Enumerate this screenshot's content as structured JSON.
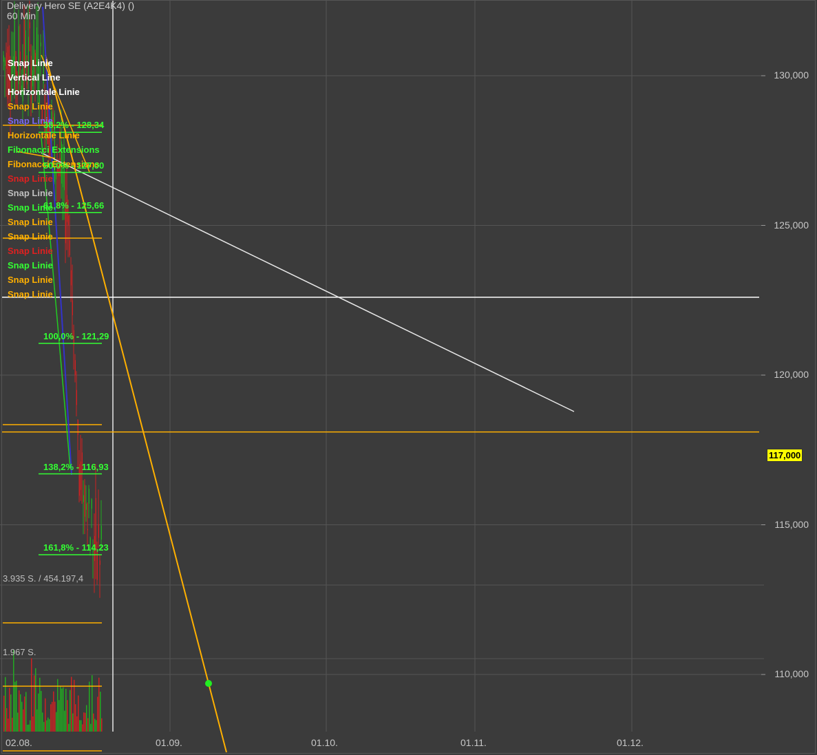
{
  "header": {
    "title": "Delivery Hero SE (A2E4K4) ()",
    "interval": "60 Min"
  },
  "legend": [
    {
      "label": "Snap Linie",
      "color": "#ffffff"
    },
    {
      "label": "Vertical Line",
      "color": "#ffffff"
    },
    {
      "label": "Horizontale Linie",
      "color": "#ffffff"
    },
    {
      "label": "Snap Linie",
      "color": "#ffb000"
    },
    {
      "label": "Snap Linie",
      "color": "#7b68ee"
    },
    {
      "label": "Horizontale Linie",
      "color": "#ffb000"
    },
    {
      "label": "Fibonacci Extensions",
      "color": "#33ff33"
    },
    {
      "label": "Fibonacci Extensions",
      "color": "#ffb000"
    },
    {
      "label": "Snap Linie",
      "color": "#e02020"
    },
    {
      "label": "Snap Linie",
      "color": "#c0c0c0"
    },
    {
      "label": "Snap Linie",
      "color": "#33ff33"
    },
    {
      "label": "Snap Linie",
      "color": "#ffb000"
    },
    {
      "label": "Snap Linie",
      "color": "#ffb000"
    },
    {
      "label": "Snap Linie",
      "color": "#e02020"
    },
    {
      "label": "Snap Linie",
      "color": "#33ff33"
    },
    {
      "label": "Snap Linie",
      "color": "#ffb000"
    },
    {
      "label": "Snap Linie",
      "color": "#ffb000"
    }
  ],
  "volume": {
    "total_label": "3.935 S. / 454.197,4",
    "max_label": "1.967 S."
  },
  "current_price_label": "117,000",
  "chart_data": {
    "type": "candlestick",
    "instrument": "Delivery Hero SE (A2E4K4)",
    "interval": "60 Min",
    "y_ticks": [
      "130,000",
      "125,000",
      "120,000",
      "115,000",
      "110,000"
    ],
    "y_tick_values": [
      130,
      125,
      120,
      115,
      110
    ],
    "x_ticks": [
      "02.08.",
      "01.09.",
      "01.10.",
      "01.11.",
      "01.12."
    ],
    "ylim": [
      107.4,
      132.6
    ],
    "last_price": 117.0,
    "approx_price_range": {
      "high": 132.5,
      "low": 112.2
    },
    "fibonacci_levels": [
      {
        "label": "38,2% - 128,34",
        "value": 128.34
      },
      {
        "label": "50,0% - 127,00",
        "value": 127.0
      },
      {
        "label": "61,8% - 125,66",
        "value": 125.66
      },
      {
        "label": "100,0% - 121,29",
        "value": 121.29
      },
      {
        "label": "138,2% - 116,93",
        "value": 116.93
      },
      {
        "label": "161,8% - 114,23",
        "value": 114.23
      }
    ],
    "horizontal_lines": [
      {
        "value": 122.6,
        "color": "#ffffff"
      },
      {
        "value": 118.1,
        "color": "#ffb000"
      }
    ],
    "colors": {
      "background": "#3b3b3b",
      "grid": "#555555",
      "up": "#22aa22",
      "down": "#cc2222",
      "orange": "#ffb000",
      "white_line": "#e8e8e8",
      "fib": "#33ff33"
    }
  }
}
